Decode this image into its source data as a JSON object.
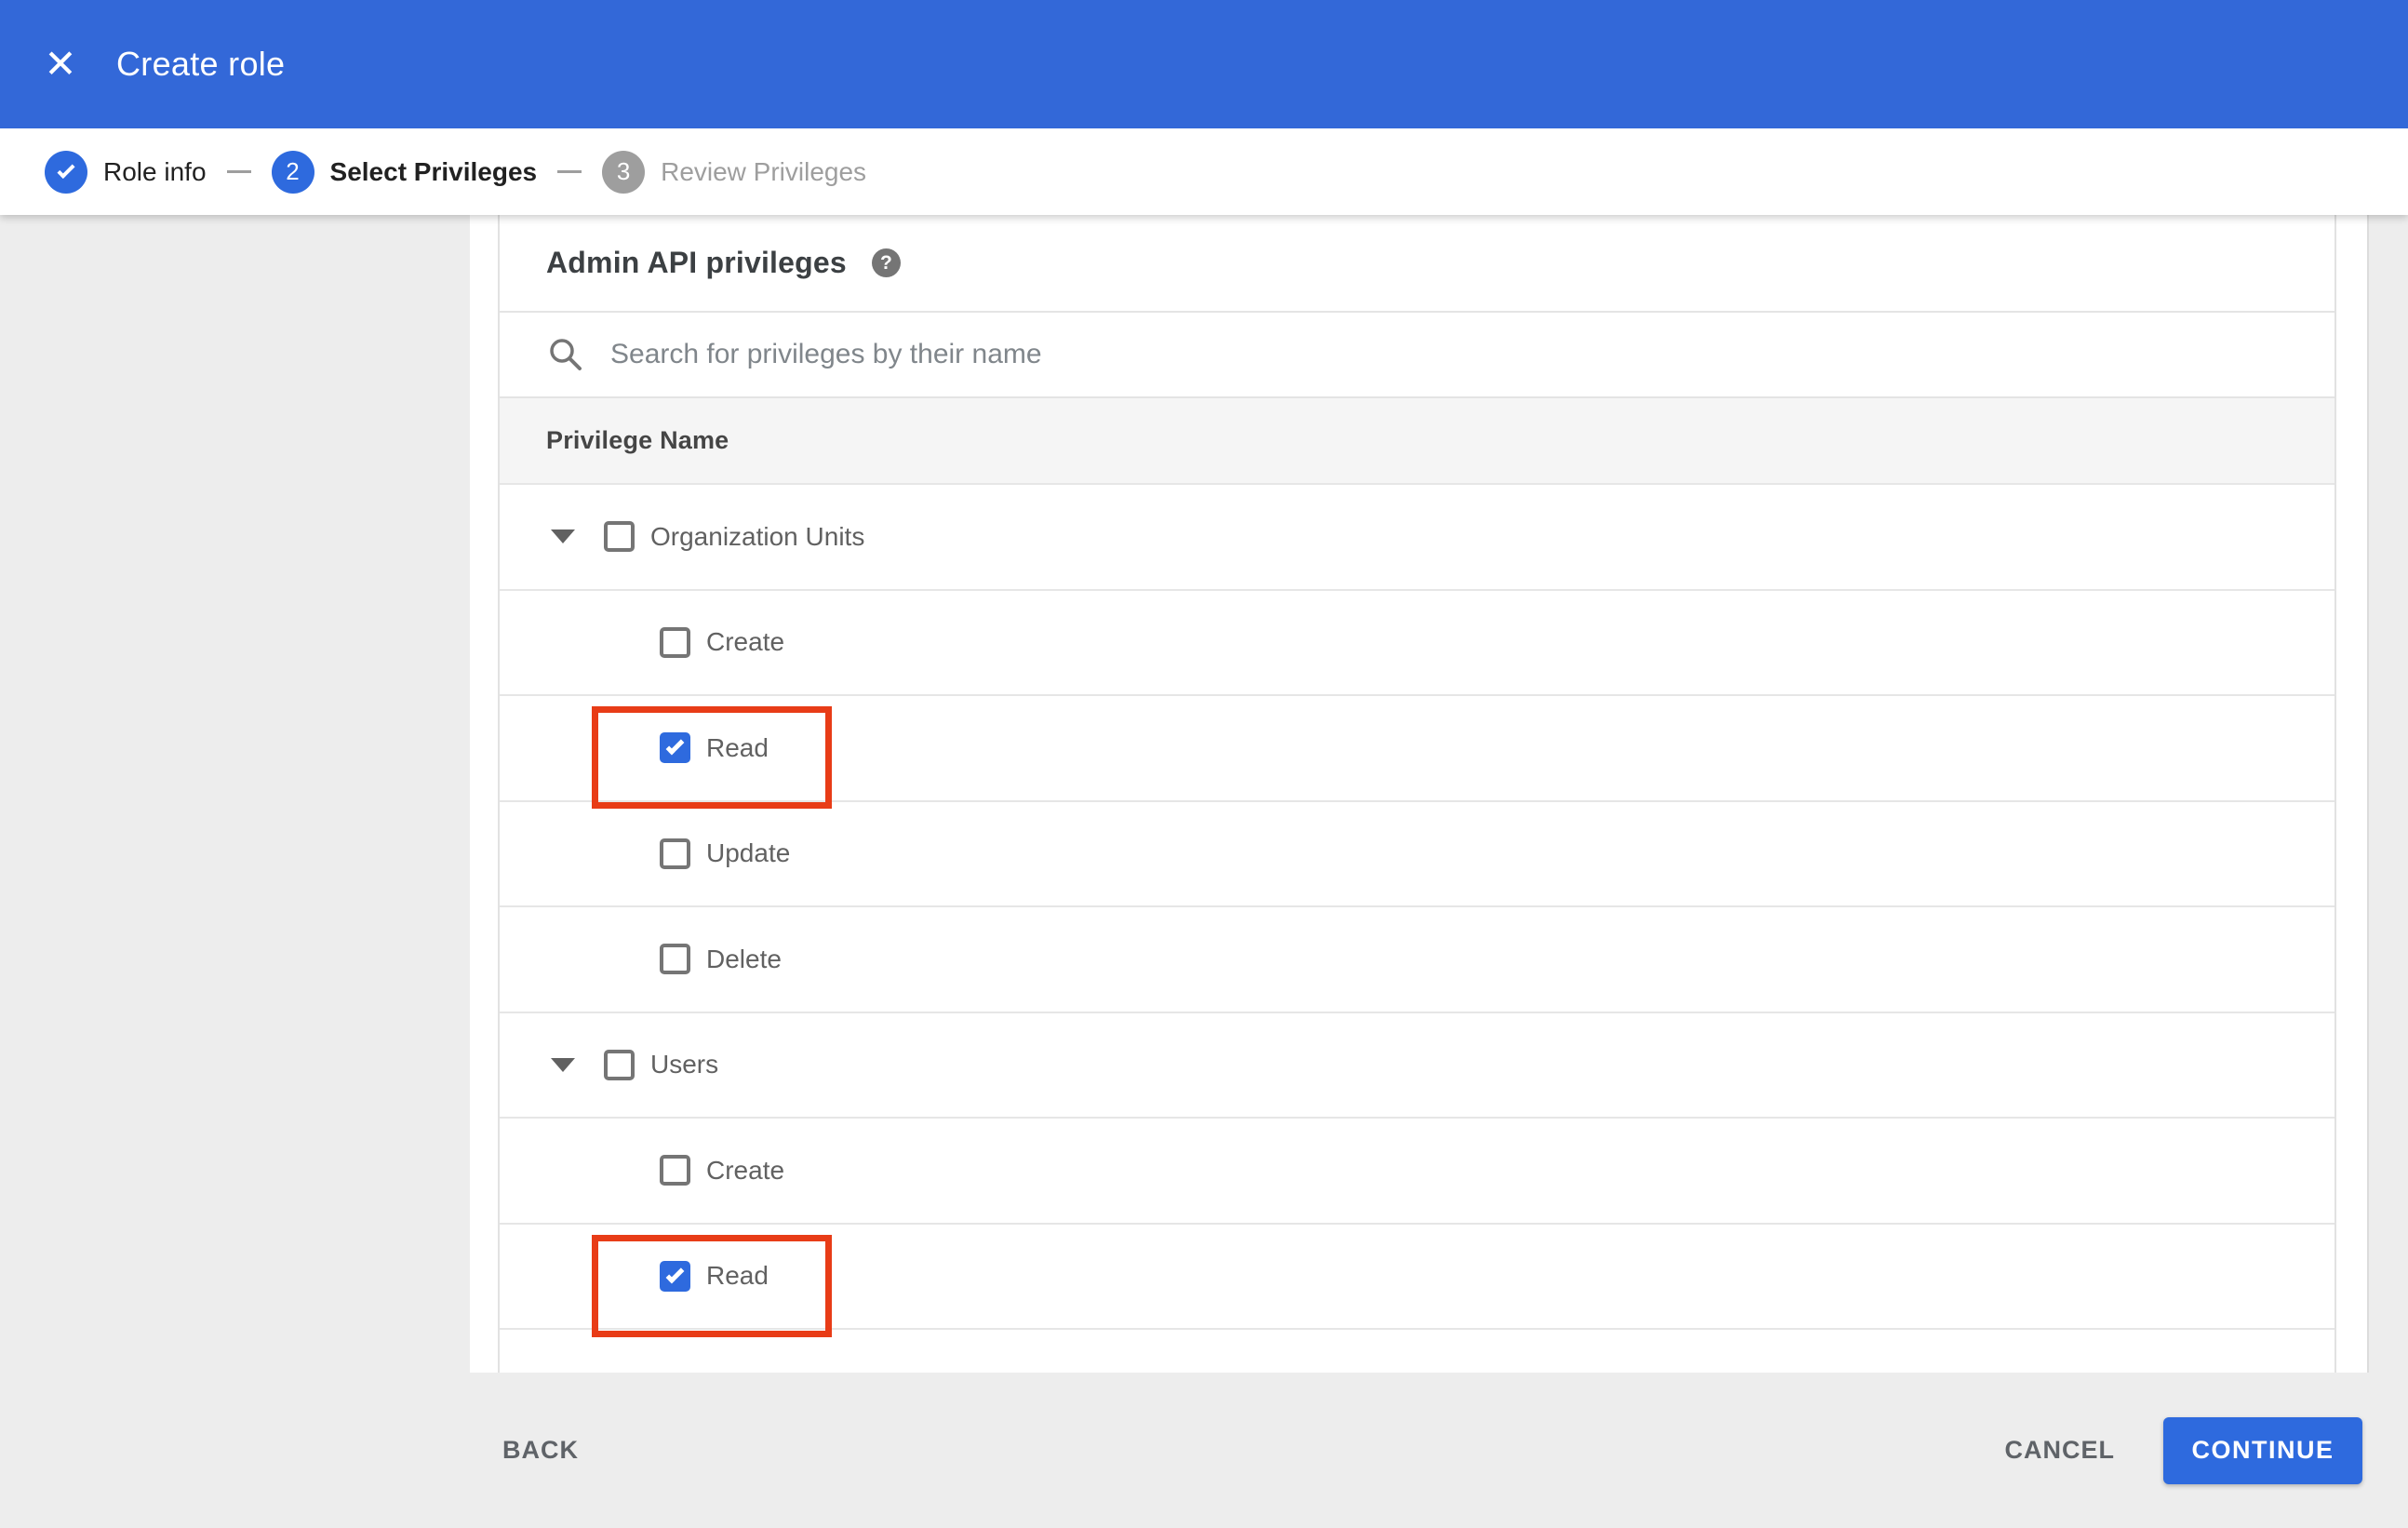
{
  "header": {
    "title": "Create role"
  },
  "icons": {
    "close_glyph": "✕",
    "help_glyph": "?"
  },
  "stepper": {
    "steps": [
      {
        "id": 1,
        "label": "Role info",
        "status": "completed",
        "indicator": "check"
      },
      {
        "id": 2,
        "label": "Select Privileges",
        "status": "active",
        "indicator": "2"
      },
      {
        "id": 3,
        "label": "Review Privileges",
        "status": "upcoming",
        "indicator": "3"
      }
    ]
  },
  "privileges_panel": {
    "heading": "Admin API privileges",
    "search": {
      "placeholder": "Search for privileges by their name",
      "value": ""
    },
    "table": {
      "header": "Privilege Name"
    },
    "rows": [
      {
        "type": "parent",
        "label": "Organization Units",
        "checked": false,
        "expanded": true,
        "highlighted": false
      },
      {
        "type": "child",
        "label": "Create",
        "checked": false,
        "highlighted": false
      },
      {
        "type": "child",
        "label": "Read",
        "checked": true,
        "highlighted": true
      },
      {
        "type": "child",
        "label": "Update",
        "checked": false,
        "highlighted": false
      },
      {
        "type": "child",
        "label": "Delete",
        "checked": false,
        "highlighted": false
      },
      {
        "type": "parent",
        "label": "Users",
        "checked": false,
        "expanded": true,
        "highlighted": false
      },
      {
        "type": "child",
        "label": "Create",
        "checked": false,
        "highlighted": false
      },
      {
        "type": "child",
        "label": "Read",
        "checked": true,
        "highlighted": true
      },
      {
        "type": "partial",
        "label": "",
        "checked": false,
        "highlighted": false
      }
    ]
  },
  "footer": {
    "back_label": "BACK",
    "cancel_label": "CANCEL",
    "continue_label": "CONTINUE"
  },
  "colors": {
    "header_blue": "#3368d8",
    "accent_blue": "#2e6ade",
    "highlight_red": "#e83c17"
  }
}
